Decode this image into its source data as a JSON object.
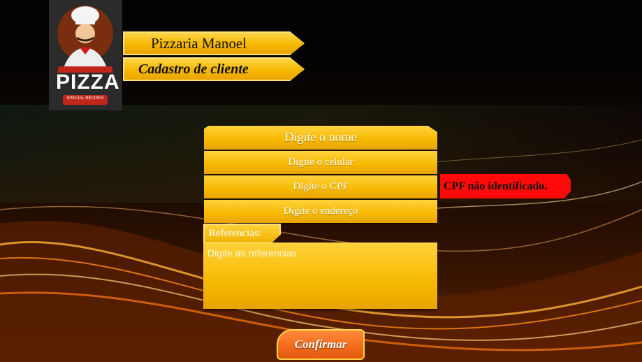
{
  "header": {
    "store_name": "Pizzaria Manoel",
    "page_subtitle": "Cadastro de cliente"
  },
  "logo": {
    "icon": "pizza-chef-logo-icon",
    "text": "PIZZA",
    "tagline": "SPECIAL RECIPES"
  },
  "form": {
    "nome_placeholder": "Digite o nome",
    "celular_placeholder": "Digite o celular",
    "cpf_placeholder": "Digite o CPF",
    "endereco_placeholder": "Digite o endereço",
    "referencias_label": "Referencias:",
    "referencias_placeholder": "Digite as referencias",
    "cpf_error": "CPF não identificado.",
    "confirm_label": "Confirmar"
  },
  "colors": {
    "field_yellow": "#f7b900",
    "error_red": "#ff0a0a",
    "confirm_orange": "#f26b1b"
  }
}
